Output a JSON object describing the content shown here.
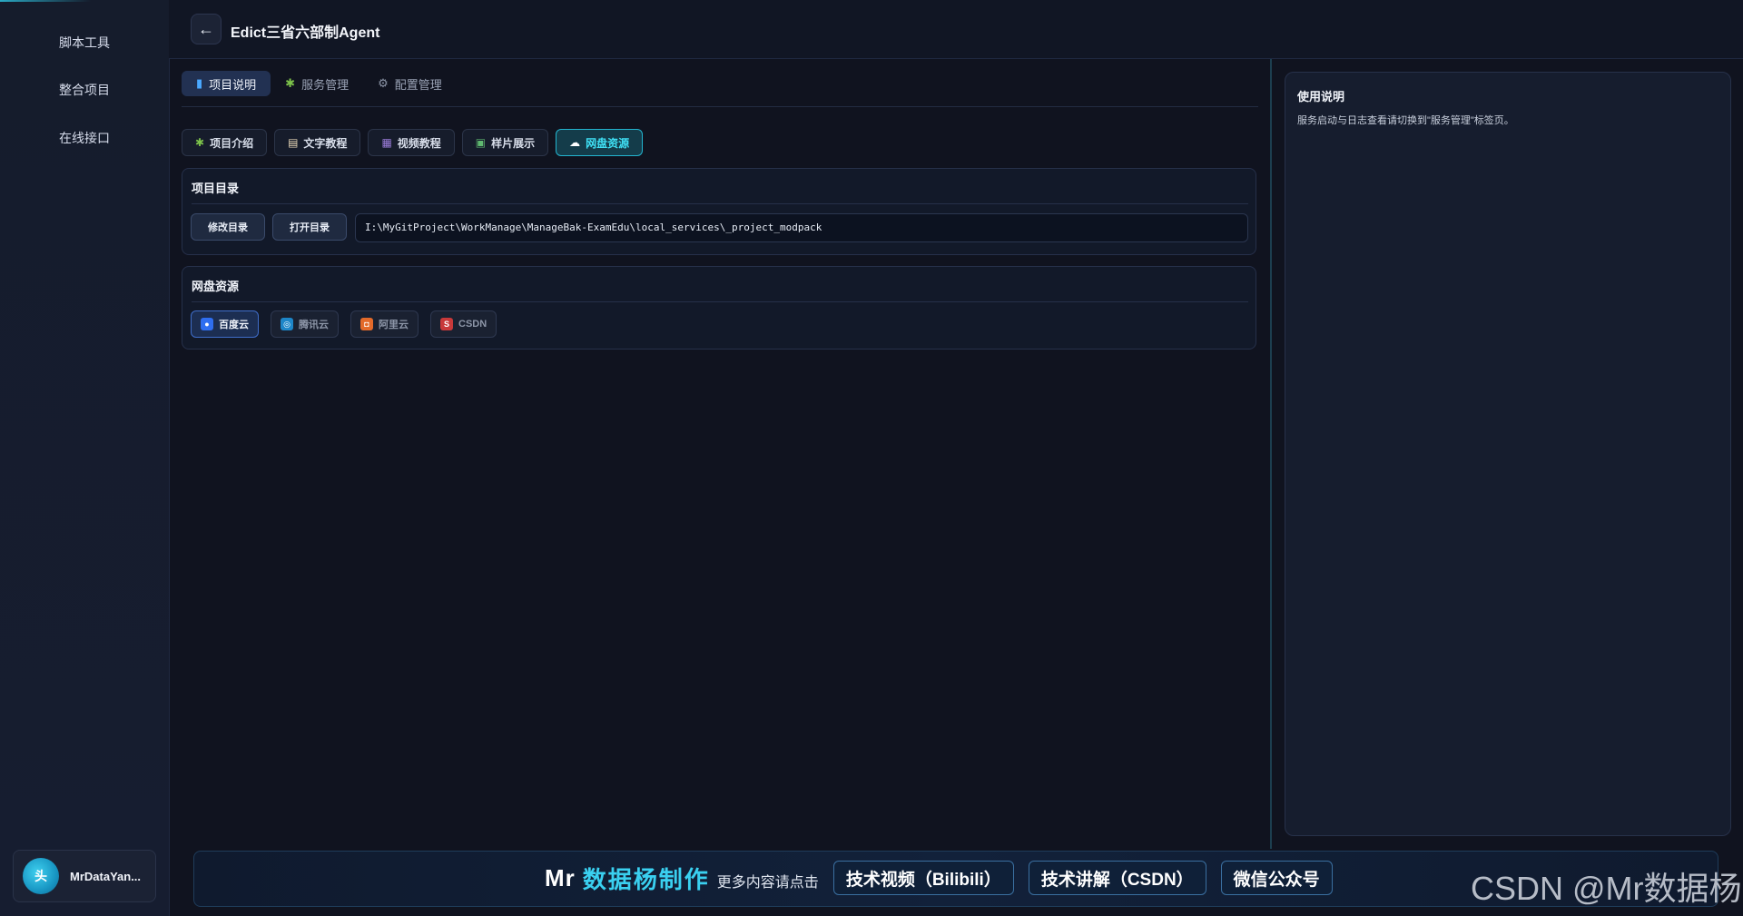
{
  "sidebar": {
    "items": [
      {
        "label": "脚本工具"
      },
      {
        "label": "整合项目"
      },
      {
        "label": "在线接口"
      }
    ],
    "user": {
      "avatar_text": "头",
      "name": "MrDataYan..."
    }
  },
  "header": {
    "back_icon": "←",
    "title": "Edict三省六部制Agent"
  },
  "top_tabs": [
    {
      "label": "项目说明",
      "icon": "book-icon",
      "glyph": "▮",
      "color": "#4aa8ff"
    },
    {
      "label": "服务管理",
      "icon": "puzzle-icon",
      "glyph": "✱",
      "color": "#7cc24a"
    },
    {
      "label": "配置管理",
      "icon": "gear-icon",
      "glyph": "⚙",
      "color": "#8d96a8"
    }
  ],
  "sub_tabs": [
    {
      "label": "项目介绍",
      "icon": "puzzle-icon",
      "glyph": "✱",
      "color": "#7cc24a"
    },
    {
      "label": "文字教程",
      "icon": "document-icon",
      "glyph": "▤",
      "color": "#e8d8b8"
    },
    {
      "label": "视频教程",
      "icon": "clapper-icon",
      "glyph": "▦",
      "color": "#9a7cd8"
    },
    {
      "label": "样片展示",
      "icon": "picture-icon",
      "glyph": "▣",
      "color": "#5fb870"
    },
    {
      "label": "网盘资源",
      "icon": "cloud-icon",
      "glyph": "☁",
      "color": "#ffffff"
    }
  ],
  "project_dir": {
    "title": "项目目录",
    "modify_label": "修改目录",
    "open_label": "打开目录",
    "path": "I:\\MyGitProject\\WorkManage\\ManageBak-ExamEdu\\local_services\\_project_modpack"
  },
  "netdisk": {
    "title": "网盘资源",
    "buttons": [
      {
        "label": "百度云",
        "icon": "baidu-icon",
        "glyph": "●",
        "color": "#2f6ef0"
      },
      {
        "label": "腾讯云",
        "icon": "tencent-icon",
        "glyph": "◎",
        "color": "#1d86c8"
      },
      {
        "label": "阿里云",
        "icon": "aliyun-icon",
        "glyph": "◘",
        "color": "#e36a2a"
      },
      {
        "label": "CSDN",
        "icon": "csdn-icon",
        "glyph": "S",
        "color": "#c8393a"
      }
    ]
  },
  "usage": {
    "title": "使用说明",
    "text": "服务启动与日志查看请切换到\"服务管理\"标签页。"
  },
  "footer": {
    "brand": "Mr",
    "brand_accent": "数据杨制作",
    "more": "更多内容请点击",
    "links": [
      {
        "label": "技术视频（Bilibili）"
      },
      {
        "label": "技术讲解（CSDN）"
      },
      {
        "label": "微信公众号"
      }
    ]
  },
  "watermark": "CSDN @Mr数据杨",
  "colors": {
    "accent": "#3ad0f0",
    "active_cloud": "#2f6ef0"
  }
}
